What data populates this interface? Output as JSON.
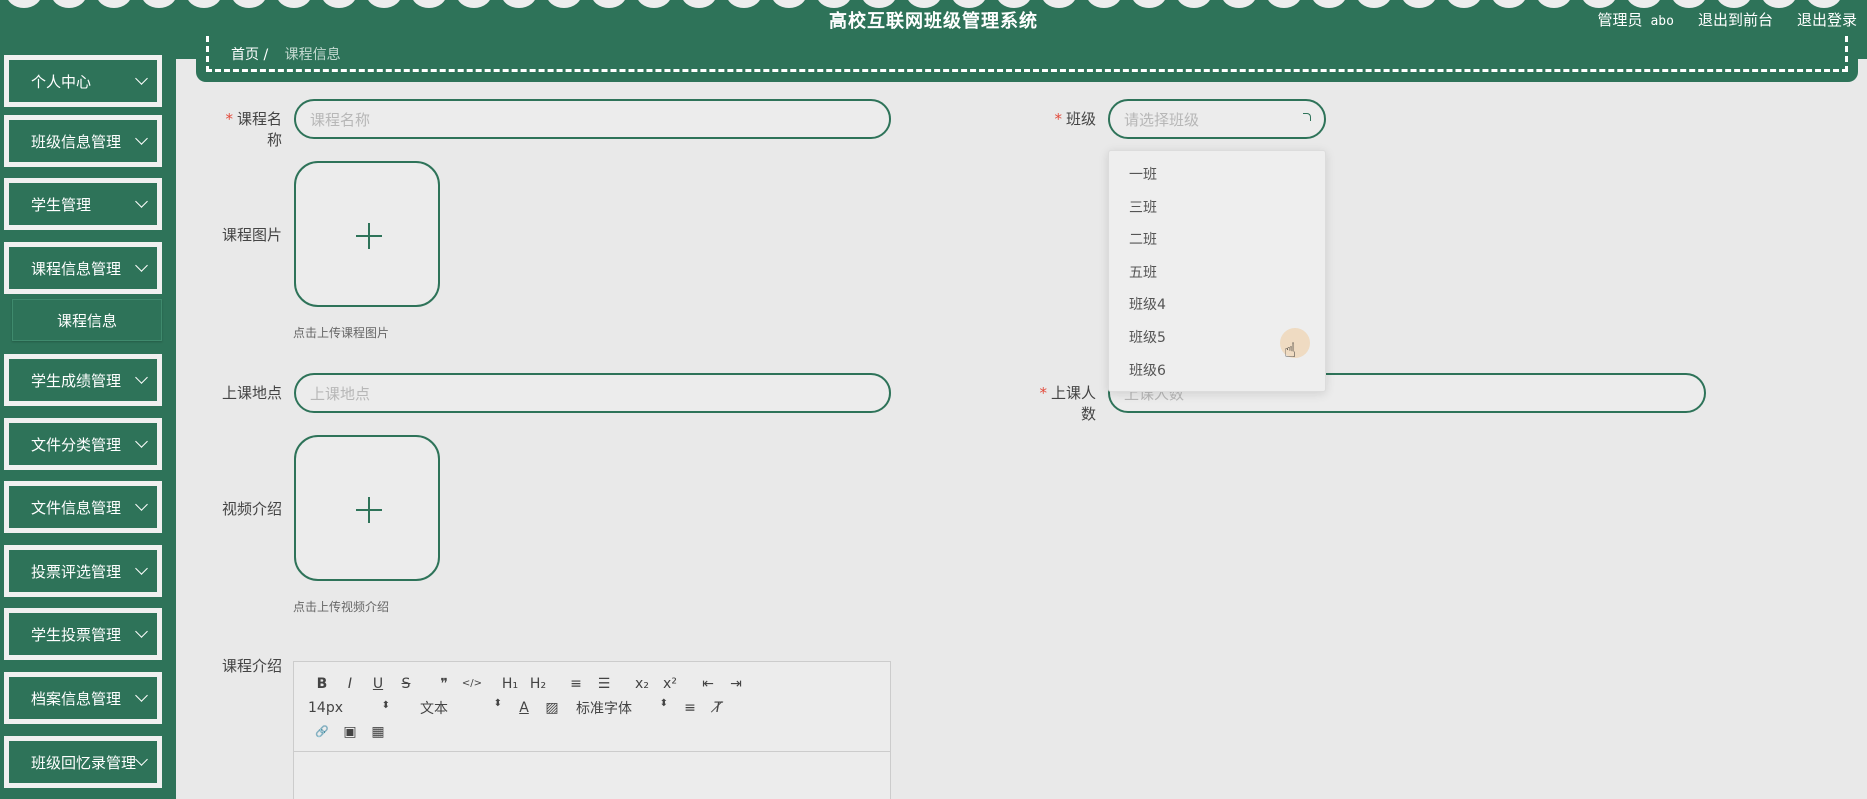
{
  "header": {
    "title": "高校互联网班级管理系统",
    "role": "管理员",
    "username": "abo",
    "front_link": "退出到前台",
    "logout_link": "退出登录"
  },
  "breadcrumb": {
    "home": "首页",
    "current": "课程信息"
  },
  "sidebar": {
    "items": [
      {
        "label": "个人中心"
      },
      {
        "label": "班级信息管理"
      },
      {
        "label": "学生管理"
      },
      {
        "label": "课程信息管理"
      },
      {
        "label": "学生成绩管理"
      },
      {
        "label": "文件分类管理"
      },
      {
        "label": "文件信息管理"
      },
      {
        "label": "投票评选管理"
      },
      {
        "label": "学生投票管理"
      },
      {
        "label": "档案信息管理"
      },
      {
        "label": "班级回忆录管理"
      }
    ],
    "sub_item": "课程信息"
  },
  "form": {
    "required_mark": "*",
    "course_name_label": "课程名称",
    "course_name_placeholder": "课程名称",
    "class_label": "班级",
    "class_placeholder": "请选择班级",
    "image_label": "课程图片",
    "image_hint": "点击上传课程图片",
    "location_label": "上课地点",
    "location_placeholder": "上课地点",
    "count_label": "上课人数",
    "count_placeholder": "上课人数",
    "video_label": "视频介绍",
    "video_hint": "点击上传视频介绍",
    "intro_label": "课程介绍"
  },
  "class_options": [
    "一班",
    "三班",
    "二班",
    "五班",
    "班级4",
    "班级5",
    "班级6"
  ],
  "editor": {
    "font_size": "14px",
    "block_format": "文本",
    "font_family": "标准字体",
    "buttons_row1": [
      {
        "icon": "bold-icon",
        "glyph": "B"
      },
      {
        "icon": "italic-icon",
        "glyph": "I"
      },
      {
        "icon": "underline-icon",
        "glyph": "U"
      },
      {
        "icon": "strike-icon",
        "glyph": "S"
      },
      {
        "icon": "quote-icon",
        "glyph": "❞"
      },
      {
        "icon": "code-icon",
        "glyph": "</>"
      },
      {
        "icon": "h1-icon",
        "glyph": "H₁"
      },
      {
        "icon": "h2-icon",
        "glyph": "H₂"
      },
      {
        "icon": "ordered-list-icon",
        "glyph": "≡"
      },
      {
        "icon": "bullet-list-icon",
        "glyph": "☰"
      },
      {
        "icon": "subscript-icon",
        "glyph": "x₂"
      },
      {
        "icon": "superscript-icon",
        "glyph": "x²"
      },
      {
        "icon": "outdent-icon",
        "glyph": "⇤"
      },
      {
        "icon": "indent-icon",
        "glyph": "⇥"
      }
    ],
    "row2_icons": [
      {
        "icon": "font-color-icon",
        "glyph": "A"
      },
      {
        "icon": "background-color-icon",
        "glyph": "▨"
      },
      {
        "icon": "align-icon",
        "glyph": "≡"
      },
      {
        "icon": "clear-format-icon",
        "glyph": "T̸"
      }
    ],
    "row3_icons": [
      {
        "icon": "link-icon",
        "glyph": "🔗"
      },
      {
        "icon": "image-icon",
        "glyph": "▣"
      },
      {
        "icon": "video-icon",
        "glyph": "▦"
      }
    ]
  }
}
